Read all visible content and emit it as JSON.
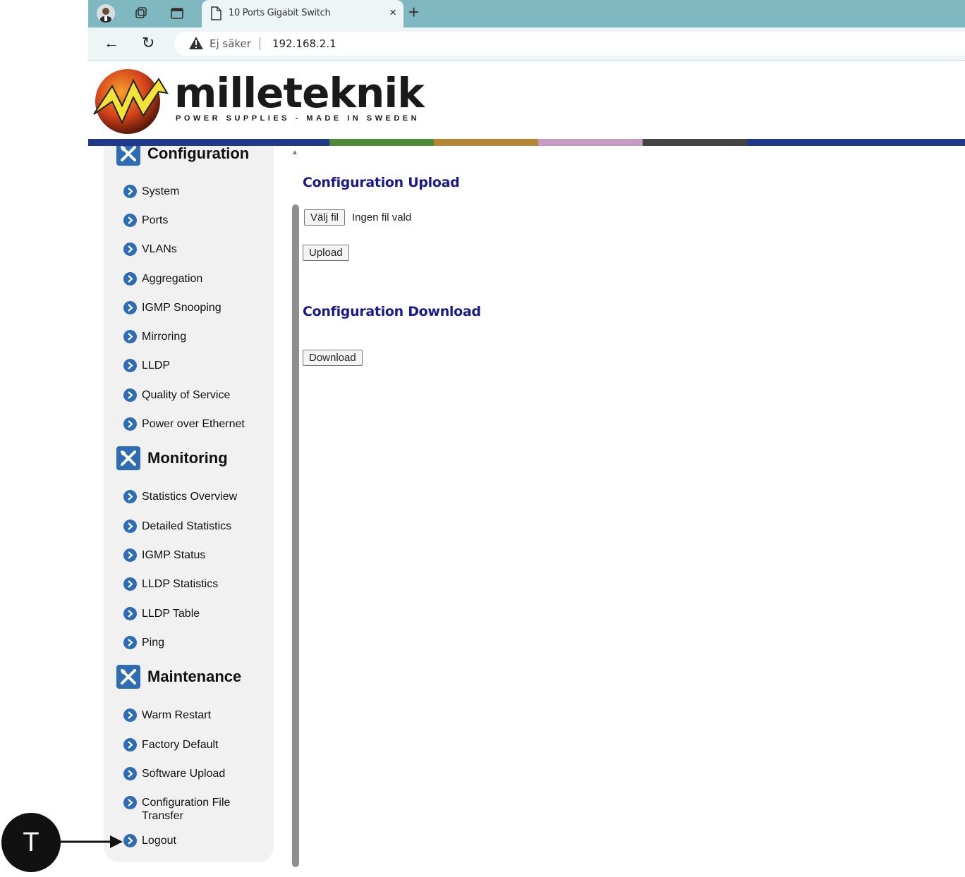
{
  "browser": {
    "tab_title": "10 Ports Gigabit Switch",
    "tab_close": "×",
    "new_tab": "+",
    "back": "←",
    "reload": "↻",
    "security_label": "Ej säker",
    "url": "192.168.2.1"
  },
  "header": {
    "brand": "milleteknik",
    "tagline": "POWER SUPPLIES - MADE IN SWEDEN",
    "stripe_colors": [
      "#1f3a8a",
      "#4f8a3a",
      "#b48532",
      "#c79ac2",
      "#444444",
      "#1f3a8a"
    ]
  },
  "sidebar": {
    "sections": [
      {
        "title": "Configuration",
        "items": [
          "System",
          "Ports",
          "VLANs",
          "Aggregation",
          "IGMP Snooping",
          "Mirroring",
          "LLDP",
          "Quality of Service",
          "Power over Ethernet"
        ]
      },
      {
        "title": "Monitoring",
        "items": [
          "Statistics Overview",
          "Detailed Statistics",
          "IGMP Status",
          "LLDP Statistics",
          "LLDP Table",
          "Ping"
        ]
      },
      {
        "title": "Maintenance",
        "items": [
          "Warm Restart",
          "Factory Default",
          "Software Upload",
          "Configuration File Transfer",
          "Logout"
        ]
      }
    ]
  },
  "main": {
    "upload_heading": "Configuration Upload",
    "choose_file_button": "Välj fil",
    "no_file_text": "Ingen fil vald",
    "upload_button": "Upload",
    "download_heading": "Configuration Download",
    "download_button": "Download"
  },
  "annotation": {
    "callout_letter": "T"
  },
  "colors": {
    "accent_blue": "#2e6db4",
    "heading_navy": "#1a1a8c",
    "tabstrip": "#7fb8c0"
  }
}
